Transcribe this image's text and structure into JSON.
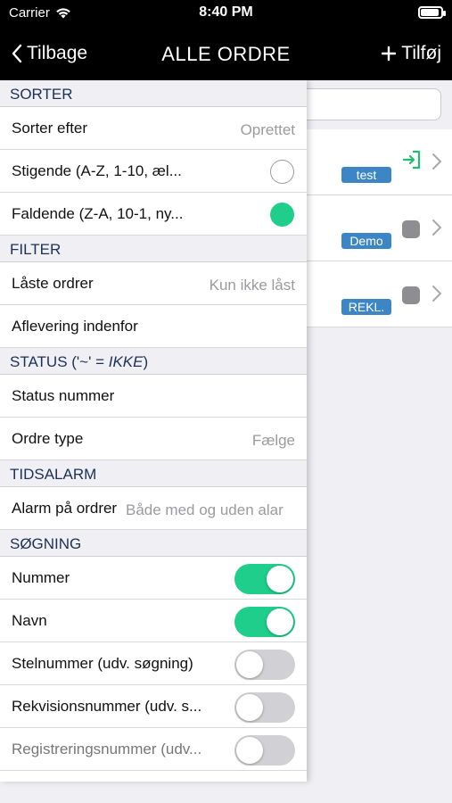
{
  "status_bar": {
    "carrier": "Carrier",
    "time": "8:40 PM"
  },
  "nav": {
    "back_label": "Tilbage",
    "title": "ALLE ORDRE",
    "add_label": "Tilføj"
  },
  "background_list": [
    {
      "tag": "test",
      "status_icon": "enter-icon"
    },
    {
      "tag": "Demo",
      "status_icon": "gray-square-icon"
    },
    {
      "tag": "REKL.",
      "status_icon": "gray-square-icon"
    }
  ],
  "sections": {
    "sorter": {
      "header": "SORTER",
      "sort_by_label": "Sorter efter",
      "sort_by_value": "Oprettet",
      "asc_label": "Stigende (A-Z, 1-10, æl...",
      "desc_label": "Faldende (Z-A, 10-1, ny..."
    },
    "filter": {
      "header": "FILTER",
      "locked_label": "Låste ordrer",
      "locked_value": "Kun ikke låst",
      "delivery_label": "Aflevering indenfor"
    },
    "status": {
      "header_prefix": "STATUS ('~' = ",
      "header_em": "IKKE",
      "header_suffix": ")",
      "status_number_label": "Status nummer",
      "order_type_label": "Ordre type",
      "order_type_value": "Fælge"
    },
    "tidsalarm": {
      "header": "TIDSALARM",
      "alarm_label": "Alarm på ordrer",
      "alarm_value": "Både med og uden alar"
    },
    "sogning": {
      "header": "SØGNING",
      "items": [
        {
          "label": "Nummer",
          "on": true
        },
        {
          "label": "Navn",
          "on": true
        },
        {
          "label": "Stelnummer (udv. søgning)",
          "on": false
        },
        {
          "label": "Rekvisionsnummer (udv. s...",
          "on": false
        },
        {
          "label": "Registreringsnummer (udv...",
          "on": false
        }
      ]
    }
  },
  "colors": {
    "accent_green": "#1fce8a",
    "header_text": "#1c3156",
    "tag_blue": "#3d86c6"
  }
}
